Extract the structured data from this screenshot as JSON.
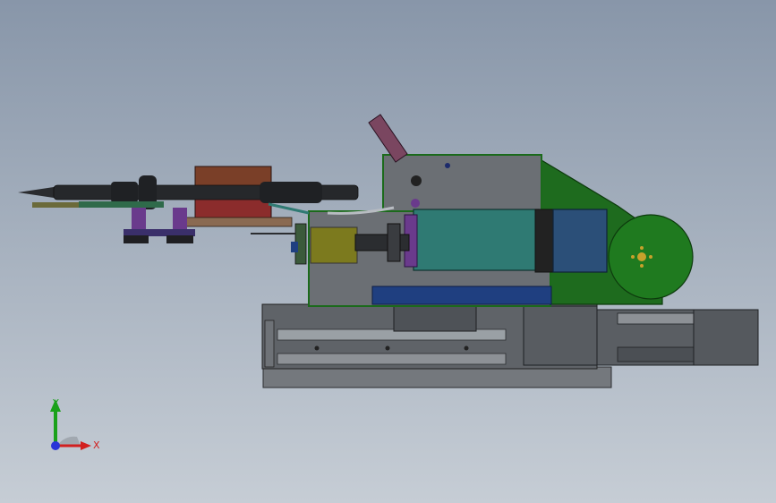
{
  "viewport": {
    "background_top": "#8896a9",
    "background_bottom": "#c6cdd5"
  },
  "triad": {
    "y_label": "Y",
    "x_label": "X",
    "y_color": "#1aa11a",
    "x_color": "#d21f1f",
    "z_color": "#2a35d8"
  },
  "colors": {
    "housing_plate": "#6b6f74",
    "green_bracket": "#1e6b1e",
    "teal_motor": "#2f7a73",
    "blue_motor": "#2b4f78",
    "red_block": "#8b2c2c",
    "brown_block": "#7a3f28",
    "purple_part": "#6a3a8c",
    "olive_block": "#7c7a1e",
    "rail_grey": "#8d9196",
    "base_grey": "#74787d"
  }
}
